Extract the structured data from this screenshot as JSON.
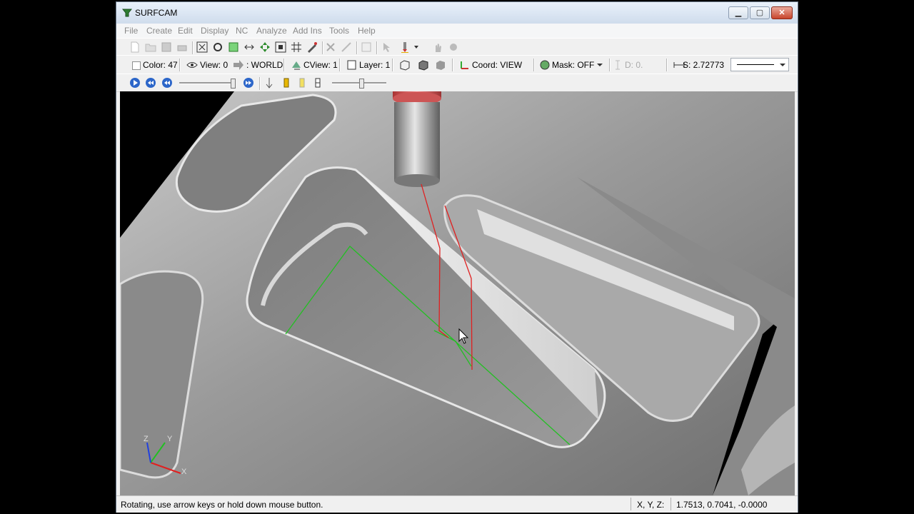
{
  "window": {
    "title": "SURFCAM"
  },
  "menu": [
    "File",
    "Create",
    "Edit",
    "Display",
    "NC",
    "Analyze",
    "Add Ins",
    "Tools",
    "Help"
  ],
  "toolbar2": {
    "color": "Color: 47",
    "view": "View: 0",
    "world": ": WORLD",
    "cview": "CView: 1",
    "layer": "Layer: 1",
    "coord": "Coord: VIEW",
    "mask": "Mask: OFF",
    "d": "D: 0.",
    "s": "S: 2.72773"
  },
  "status": {
    "message": "Rotating, use arrow keys or hold down mouse button.",
    "coord_label": "X, Y, Z:",
    "coord_value": "1.7513, 0.7041, -0.0000"
  },
  "axis": {
    "x": "X",
    "y": "Y",
    "z": "Z"
  },
  "colors": {
    "toolpath_green": "#22c022",
    "toolpath_red": "#e02020",
    "tool_tip": "#d94040"
  }
}
